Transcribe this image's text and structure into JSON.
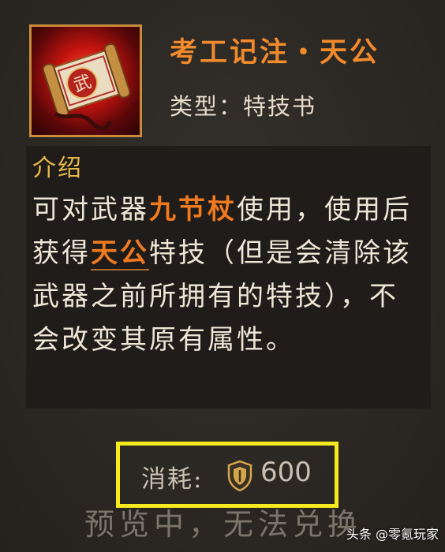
{
  "item": {
    "title": "考工记注・天公",
    "type_label": "类型：",
    "type_value": "特技书",
    "icon": "scroll-book-icon",
    "icon_glyph": "武"
  },
  "description": {
    "heading": "介绍",
    "segments": {
      "s1": "可对武器",
      "weapon": "九节杖",
      "s2": "使用，使用后获得",
      "skill": "天公",
      "s3": "特技（但是会清除该武器之前所拥有的特技），不会改变其原有属性。"
    }
  },
  "cost": {
    "label": "消耗:",
    "icon": "shield-currency-icon",
    "value": "600",
    "highlight_color": "#f4ea1e"
  },
  "preview_notice": "预览中，无法兑换",
  "watermark": {
    "text": "头条 @零氪玩家"
  },
  "colors": {
    "title": "#f08a2c",
    "heading": "#e7b84a",
    "highlight": "#f07a20",
    "body_text": "#efe6d8"
  }
}
